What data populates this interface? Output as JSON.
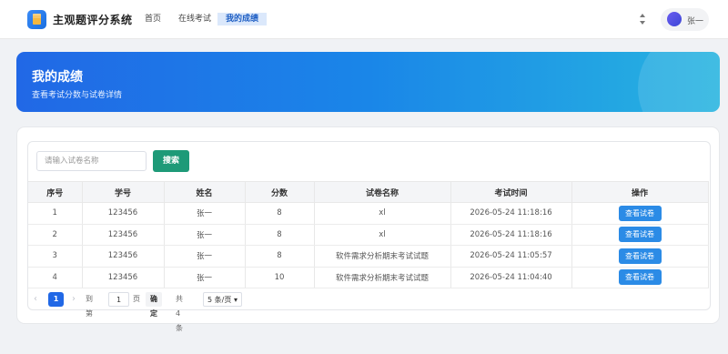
{
  "app": {
    "title": "主观题评分系统"
  },
  "nav": [
    {
      "label": "首页",
      "active": false
    },
    {
      "label": "在线考试",
      "active": false
    },
    {
      "label": "我的成绩",
      "active": true
    }
  ],
  "user": {
    "name": "张一"
  },
  "banner": {
    "title": "我的成绩",
    "subtitle": "查看考试分数与试卷详情"
  },
  "search": {
    "placeholder": "请输入试卷名称",
    "button_label": "搜索"
  },
  "table": {
    "headers": [
      "序号",
      "学号",
      "姓名",
      "分数",
      "试卷名称",
      "考试时间",
      "操作"
    ],
    "action_label": "查看试卷",
    "rows": [
      [
        "1",
        "123456",
        "张一",
        "8",
        "xl",
        "2026-05-24 11:18:16"
      ],
      [
        "2",
        "123456",
        "张一",
        "8",
        "xl",
        "2026-05-24 11:18:16"
      ],
      [
        "3",
        "123456",
        "张一",
        "8",
        "软件需求分析期末考试试题",
        "2026-05-24 11:05:57"
      ],
      [
        "4",
        "123456",
        "张一",
        "10",
        "软件需求分析期末考试试题",
        "2026-05-24 11:04:40"
      ]
    ]
  },
  "pagination": {
    "prev": "‹",
    "current_page": "1",
    "next": "›",
    "goto_prefix": "到第",
    "goto_value": "1",
    "goto_suffix": "页",
    "confirm_label": "确定",
    "total_text": "共 4 条",
    "page_size": "5 条/页"
  },
  "colors": {
    "primary": "#2168e6",
    "search_button": "#1e9a78",
    "action_button": "#2b8be6"
  }
}
